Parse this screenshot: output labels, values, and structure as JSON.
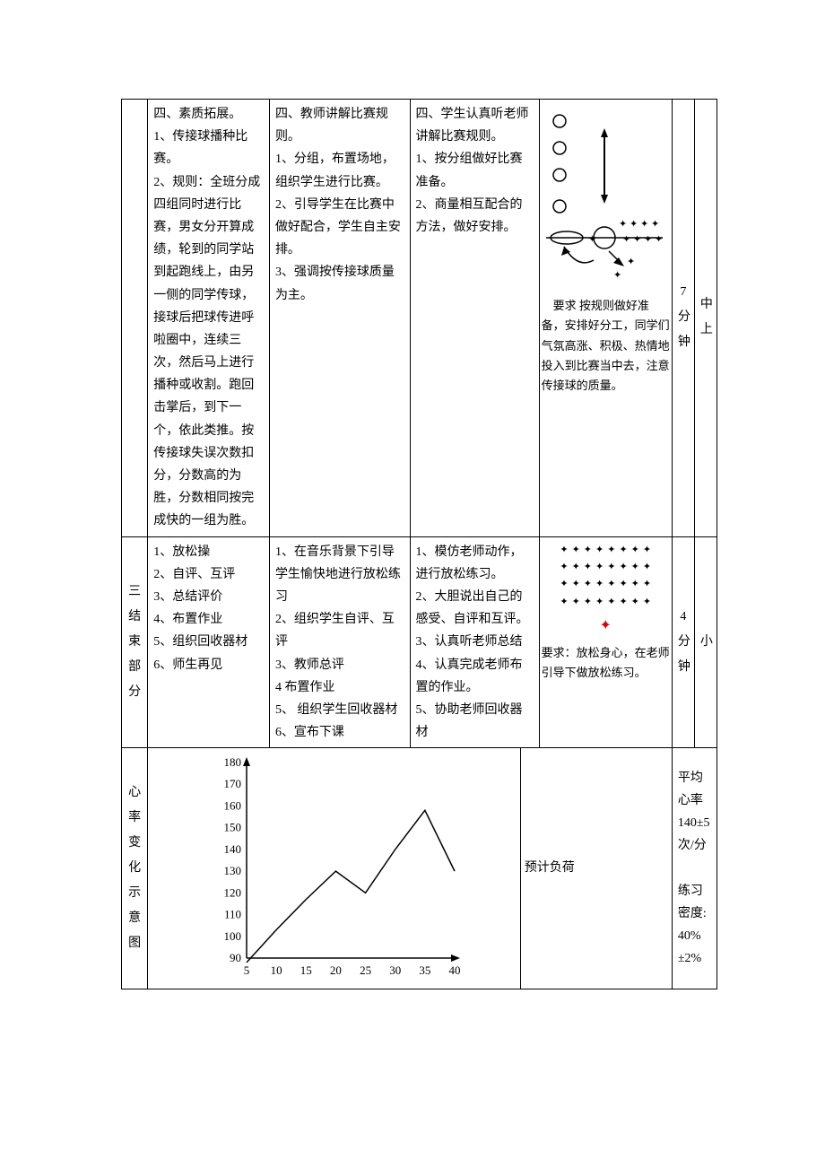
{
  "row1": {
    "col1": "四、素质拓展。\n1、传接球播种比赛。\n2、规则：全班分成四组同时进行比赛，男女分开算成绩，轮到的同学站到起跑线上，由另一侧的同学传球，接球后把球传进呼啦圈中，连续三次，然后马上进行播种或收割。跑回击掌后，到下一个，依此类推。按传接球失误次数扣分，分数高的为胜，分数相同按完成快的一组为胜。",
    "col2": "四、教师讲解比赛规则。\n1、分组，布置场地，组织学生进行比赛。\n2、引导学生在比赛中做好配合，学生自主安排。\n3、强调按传接球质量为主。",
    "col3": "四、学生认真听老师讲解比赛规则。\n1、按分组做好比赛准备。\n2、商量相互配合的方法，做好安排。",
    "formation_req": "要求 按规则做好准备，安排好分工，同学们气氛高涨、积极、热情地投入到比赛当中去，注意传接球的质量。",
    "time": "7分钟",
    "intensity": "中上"
  },
  "row2": {
    "section_label": "三结束部分",
    "col1": "1、放松操\n2、自评、互评\n3、总结评价\n4、布置作业\n5、组织回收器材\n6、师生再见",
    "col2": "1、在音乐背景下引导学生愉快地进行放松练习\n2、组织学生自评、互评\n3、教师总评\n4 布置作业\n5、 组织学生回收器材\n6、宣布下课",
    "col3": "1、模仿老师动作，进行放松练习。\n2、大胆说出自己的感受、自评和互评。\n3、认真听老师总结\n4、认真完成老师布置的作业。\n5、协助老师回收器材",
    "formation_req": "要求：放松身心，在老师引导下做放松练习。",
    "time": "4分钟",
    "intensity": "小"
  },
  "row3": {
    "left_label": "心率变化示意图",
    "mid_label": "预计负荷",
    "right_text": "平均心率 140±5 次/分\n\n练习密度:40%±2%"
  },
  "chart_data": {
    "type": "line",
    "x": [
      5,
      10,
      15,
      20,
      25,
      30,
      35,
      40
    ],
    "y": [
      88,
      103,
      117,
      130,
      120,
      140,
      158,
      130
    ],
    "xlabel": "",
    "ylabel": "",
    "xlim": [
      5,
      40
    ],
    "ylim": [
      90,
      180
    ],
    "xticks": [
      5,
      10,
      15,
      20,
      25,
      30,
      35,
      40
    ],
    "yticks": [
      90,
      100,
      110,
      120,
      130,
      140,
      150,
      160,
      170,
      180
    ]
  }
}
